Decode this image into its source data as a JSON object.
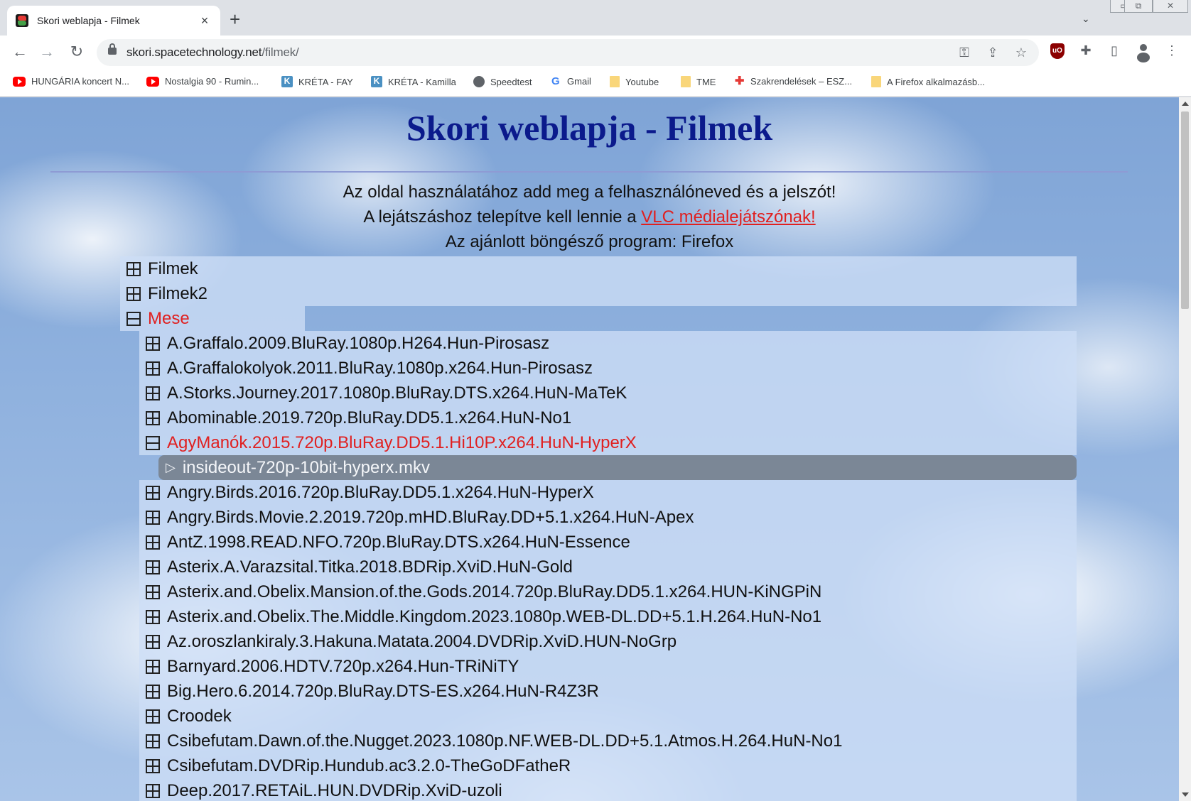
{
  "browser": {
    "tab_title": "Skori weblapja - Filmek",
    "tab_close": "×",
    "new_tab": "+",
    "tab_search": "⌄",
    "window_buttons": [
      "▭",
      "⧉",
      "✕"
    ],
    "url_host": "skori.spacetechnology.net",
    "url_path": "/filmek/",
    "nav": {
      "back": "←",
      "forward": "→",
      "reload": "↻"
    },
    "omnibox_icons": {
      "key": "⚿",
      "share": "⇪",
      "star": "☆"
    },
    "toolbar_icons": {
      "ublock": "uO",
      "extensions": "✚",
      "sidepanel": "▯",
      "menu": "⋮"
    }
  },
  "bookmarks": [
    {
      "label": "HUNGÁRIA koncert N...",
      "icon": "youtube-icon"
    },
    {
      "label": "Nostalgia 90 - Rumin...",
      "icon": "youtube-icon"
    },
    {
      "label": "KRÉTA - FAY",
      "icon": "kreta-icon"
    },
    {
      "label": "KRÉTA - Kamilla",
      "icon": "kreta-icon"
    },
    {
      "label": "Speedtest",
      "icon": "globe-icon"
    },
    {
      "label": "Gmail",
      "icon": "google-icon"
    },
    {
      "label": "Youtube",
      "icon": "folder-icon"
    },
    {
      "label": "TME",
      "icon": "folder-icon"
    },
    {
      "label": "Szakrendelések – ESZ...",
      "icon": "red-cross-icon"
    },
    {
      "label": "A Firefox alkalmazásb...",
      "icon": "folder-icon"
    }
  ],
  "page": {
    "title": "Skori weblapja - Filmek",
    "line1": "Az oldal használatához add meg a felhasználóneved és a jelszót!",
    "line2_prefix": "A lejátszáshoz telepítve kell lennie a ",
    "line2_link": "VLC médialejátszónak!",
    "line3": "Az ajánlott böngésző program: Firefox"
  },
  "tree": {
    "roots": [
      "Filmek",
      "Filmek2",
      "Mese"
    ],
    "open_folder": "AgyManók.2015.720p.BluRay.DD5.1.Hi10P.x264.HuN-HyperX",
    "file": "insideout-720p-10bit-hyperx.mkv",
    "file_icon": "▷",
    "mese_items_before": [
      "A.Graffalo.2009.BluRay.1080p.H264.Hun-Pirosasz",
      "A.Graffalokolyok.2011.BluRay.1080p.x264.Hun-Pirosasz",
      "A.Storks.Journey.2017.1080p.BluRay.DTS.x264.HuN-MaTeK",
      "Abominable.2019.720p.BluRay.DD5.1.x264.HuN-No1"
    ],
    "mese_items_after": [
      "Angry.Birds.2016.720p.BluRay.DD5.1.x264.HuN-HyperX",
      "Angry.Birds.Movie.2.2019.720p.mHD.BluRay.DD+5.1.x264.HuN-Apex",
      "AntZ.1998.READ.NFO.720p.BluRay.DTS.x264.HuN-Essence",
      "Asterix.A.Varazsital.Titka.2018.BDRip.XviD.HuN-Gold",
      "Asterix.and.Obelix.Mansion.of.the.Gods.2014.720p.BluRay.DD5.1.x264.HUN-KiNGPiN",
      "Asterix.and.Obelix.The.Middle.Kingdom.2023.1080p.WEB-DL.DD+5.1.H.264.HuN-No1",
      "Az.oroszlankiraly.3.Hakuna.Matata.2004.DVDRip.XviD.HUN-NoGrp",
      "Barnyard.2006.HDTV.720p.x264.Hun-TRiNiTY",
      "Big.Hero.6.2014.720p.BluRay.DTS-ES.x264.HuN-R4Z3R",
      "Croodek",
      "Csibefutam.Dawn.of.the.Nugget.2023.1080p.NF.WEB-DL.DD+5.1.Atmos.H.264.HuN-No1",
      "Csibefutam.DVDRip.Hundub.ac3.2.0-TheGoDFatheR",
      "Deep.2017.RETAiL.HUN.DVDRip.XviD-uzoli"
    ]
  },
  "colors": {
    "title": "#0b1a8c",
    "open_item": "#e02020",
    "selected_file_bg": "#7b8796"
  }
}
